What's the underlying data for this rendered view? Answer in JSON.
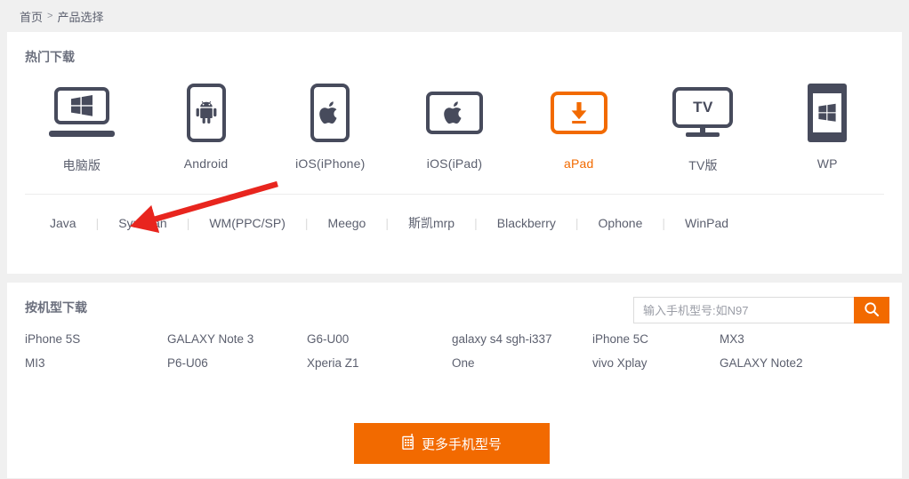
{
  "breadcrumb": {
    "home": "首页",
    "separator": ">",
    "current": "产品选择"
  },
  "hot_downloads": {
    "title": "热门下载",
    "accent_color": "#f26a00",
    "dark_color": "#474b5c",
    "platforms": [
      {
        "label": "电脑版",
        "icon": "laptop-windows-icon",
        "active": false
      },
      {
        "label": "Android",
        "icon": "phone-android-icon",
        "active": false
      },
      {
        "label": "iOS(iPhone)",
        "icon": "phone-apple-icon",
        "active": false
      },
      {
        "label": "iOS(iPad)",
        "icon": "tablet-apple-icon",
        "active": false
      },
      {
        "label": "aPad",
        "icon": "tablet-download-icon",
        "active": true
      },
      {
        "label": "TV版",
        "icon": "tv-icon",
        "active": false
      },
      {
        "label": "WP",
        "icon": "phone-windows-icon",
        "active": false
      }
    ],
    "sub_platforms": [
      "Java",
      "Symbian",
      "WM(PPC/SP)",
      "Meego",
      "斯凯mrp",
      "Blackberry",
      "Ophone",
      "WinPad"
    ],
    "tv_icon_text": "TV"
  },
  "annotation": {
    "type": "arrow",
    "color": "#e8251e",
    "points_to": "Symbian"
  },
  "by_model": {
    "title": "按机型下载",
    "search": {
      "placeholder": "输入手机型号:如N97",
      "value": "",
      "button_icon": "search-icon"
    },
    "models": [
      "iPhone 5S",
      "GALAXY Note 3",
      "G6-U00",
      "galaxy s4 sgh-i337",
      "iPhone 5C",
      "MX3",
      "MI3",
      "P6-U06",
      "Xperia Z1",
      "One",
      "vivo Xplay",
      "GALAXY Note2"
    ],
    "more_button": {
      "label": "更多手机型号",
      "icon": "mobile-phone-icon"
    }
  }
}
